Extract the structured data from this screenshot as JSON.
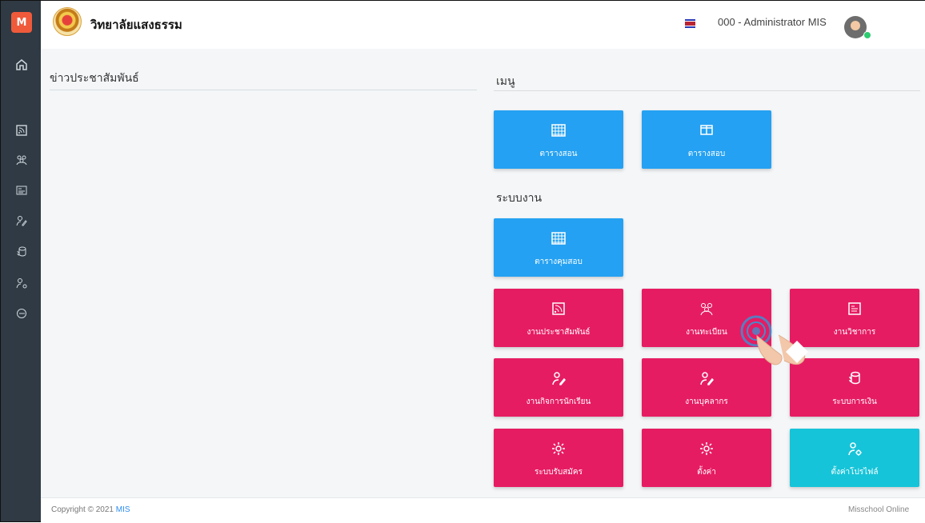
{
  "app": {
    "logo": "M",
    "school_name": "วิทยาลัยแสงธรรม",
    "user_label": "000 - Administrator MIS"
  },
  "sidebar": {
    "icons": [
      "home-icon",
      "rss-icon",
      "group-icon",
      "news-icon",
      "edit-user-icon",
      "coins-icon",
      "user-settings-icon",
      "logout-icon"
    ]
  },
  "news": {
    "title": "ข่าวประชาสัมพันธ์"
  },
  "menu": {
    "title": "เมนู",
    "tiles": [
      "ตารางสอน",
      "ตารางสอบ"
    ]
  },
  "system": {
    "title": "ระบบงาน",
    "tiles": [
      "ตารางคุมสอบ",
      "งานประชาสัมพันธ์",
      "งานทะเบียน",
      "งานวิชาการ",
      "งานกิจการนักเรียน",
      "งานบุคลากร",
      "ระบบการเงิน",
      "ระบบรับสมัคร",
      "ตั้งค่า",
      "ตั้งค่าโปรไฟล์"
    ]
  },
  "footer": {
    "copyright": "Copyright © 2021",
    "brand": "MIS",
    "right": "Misschool Online"
  },
  "colors": {
    "sidebar": "#2f3a44",
    "blue_tile": "#24a1f2",
    "pink_tile": "#e61c62",
    "cyan_tile": "#16c4d9"
  }
}
